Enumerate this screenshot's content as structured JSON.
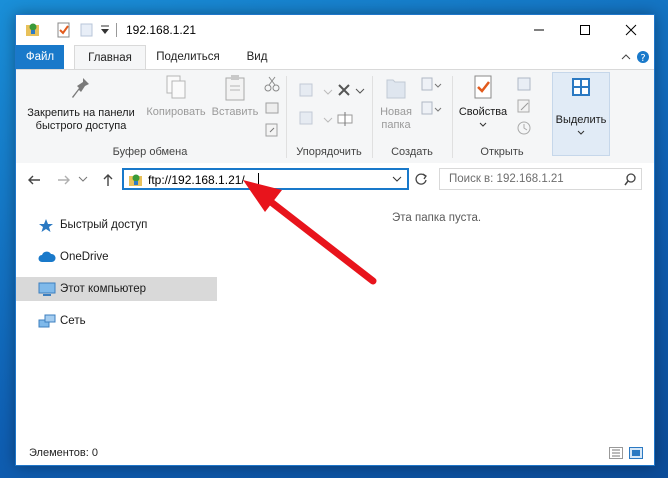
{
  "window": {
    "title": "192.168.1.21"
  },
  "tabs": [
    {
      "label": "Файл"
    },
    {
      "label": "Главная"
    },
    {
      "label": "Поделиться"
    },
    {
      "label": "Вид"
    }
  ],
  "ribbon": {
    "clipboard": {
      "pin_line1": "Закрепить на панели",
      "pin_line2": "быстрого доступа",
      "copy": "Копировать",
      "paste": "Вставить",
      "group": "Буфер обмена"
    },
    "organize": {
      "group": "Упорядочить"
    },
    "new": {
      "folder_line1": "Новая",
      "folder_line2": "папка",
      "group": "Создать"
    },
    "open": {
      "properties": "Свойства",
      "group": "Открыть"
    },
    "select": {
      "label": "Выделить"
    }
  },
  "address": {
    "value": "ftp://192.168.1.21/",
    "search_placeholder": "Поиск в: 192.168.1.21"
  },
  "sidebar": {
    "items": [
      {
        "label": "Быстрый доступ",
        "icon": "star-icon"
      },
      {
        "label": "OneDrive",
        "icon": "cloud-icon"
      },
      {
        "label": "Этот компьютер",
        "icon": "computer-icon",
        "selected": true
      },
      {
        "label": "Сеть",
        "icon": "network-icon"
      }
    ]
  },
  "content": {
    "empty_text": "Эта папка пуста."
  },
  "status": {
    "items": "Элементов: 0"
  },
  "colors": {
    "accent": "#1979ca",
    "arrow": "#e8141c",
    "desktop": "#1278c8"
  }
}
